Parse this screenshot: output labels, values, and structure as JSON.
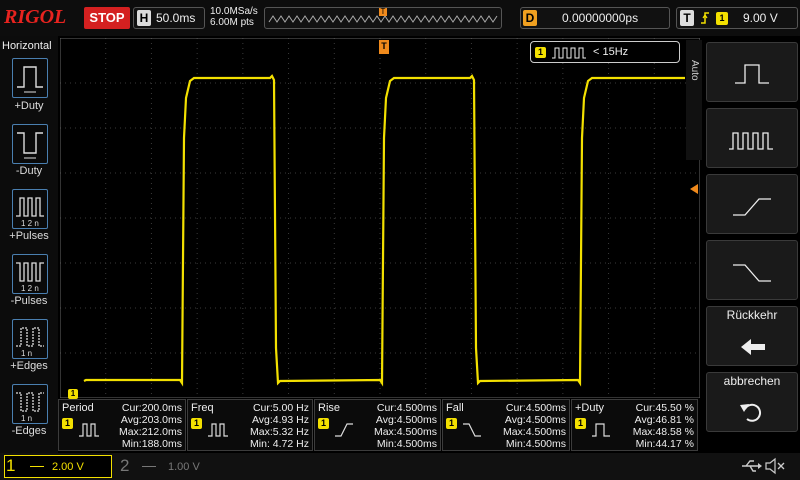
{
  "topbar": {
    "logo": "RIGOL",
    "run_state": "STOP",
    "h_key": "H",
    "timebase": "50.0ms",
    "sample_rate": "10.0MSa/s",
    "mem_depth": "6.00M pts",
    "trig_pos_marker": "T",
    "d_key": "D",
    "delay": "0.00000000ps",
    "t_key": "T",
    "trig_channel": "1",
    "trig_level": "9.00 V"
  },
  "horizontal_menu": {
    "title": "Horizontal",
    "items": [
      {
        "label": "+Duty",
        "icon": "pos-duty-icon"
      },
      {
        "label": "-Duty",
        "icon": "neg-duty-icon"
      },
      {
        "label": "+Pulses",
        "icon": "pos-pulses-icon"
      },
      {
        "label": "-Pulses",
        "icon": "neg-pulses-icon"
      },
      {
        "label": "+Edges",
        "icon": "pos-edges-icon"
      },
      {
        "label": "-Edges",
        "icon": "neg-edges-icon"
      }
    ]
  },
  "waveform": {
    "ch1_marker": "1",
    "trig_marker": "T",
    "freq_badge_ch": "1",
    "freq_badge_text": "< 15Hz",
    "color": "#f3e000"
  },
  "right_menu": {
    "auto_label": "Auto",
    "back_label": "Rückkehr",
    "cancel_label": "abbrechen",
    "buttons": [
      "single-pulse-icon",
      "pulse-train-icon",
      "rising-edge-icon",
      "falling-edge-icon"
    ]
  },
  "measurements": [
    {
      "title": "Period",
      "cur": "Cur:200.0ms",
      "avg": "Avg:203.0ms",
      "max": "Max:212.0ms",
      "min": "Min:188.0ms"
    },
    {
      "title": "Freq",
      "cur": "Cur:5.00 Hz",
      "avg": "Avg:4.93 Hz",
      "max": "Max:5.32 Hz",
      "min": "Min: 4.72 Hz"
    },
    {
      "title": "Rise",
      "cur": "Cur:4.500ms",
      "avg": "Avg:4.500ms",
      "max": "Max:4.500ms",
      "min": "Min:4.500ms"
    },
    {
      "title": "Fall",
      "cur": "Cur:4.500ms",
      "avg": "Avg:4.500ms",
      "max": "Max:4.500ms",
      "min": "Min:4.500ms"
    },
    {
      "title": "+Duty",
      "cur": "Cur:45.50 %",
      "avg": "Avg:46.81 %",
      "max": "Max:48.58 %",
      "min": "Min:44.17 %"
    }
  ],
  "channels": {
    "ch1_num": "1",
    "ch1_scale": "2.00 V",
    "ch2_num": "2",
    "ch2_scale": "1.00 V"
  },
  "colors": {
    "ch1": "#f3e000",
    "stop": "#d42020",
    "delay_key": "#f0a020",
    "menu_border": "#4a7fb0"
  }
}
